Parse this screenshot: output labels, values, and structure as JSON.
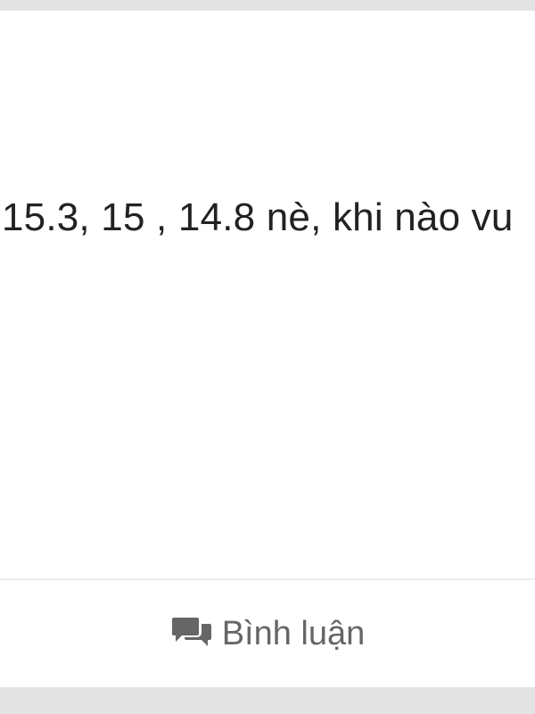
{
  "post": {
    "text": "15.3, 15 , 14.8 nè, khi nào vu"
  },
  "actions": {
    "comment_label": "Bình luận",
    "comment_icon": "comment-bubbles-icon",
    "icon_color": "#666666"
  }
}
